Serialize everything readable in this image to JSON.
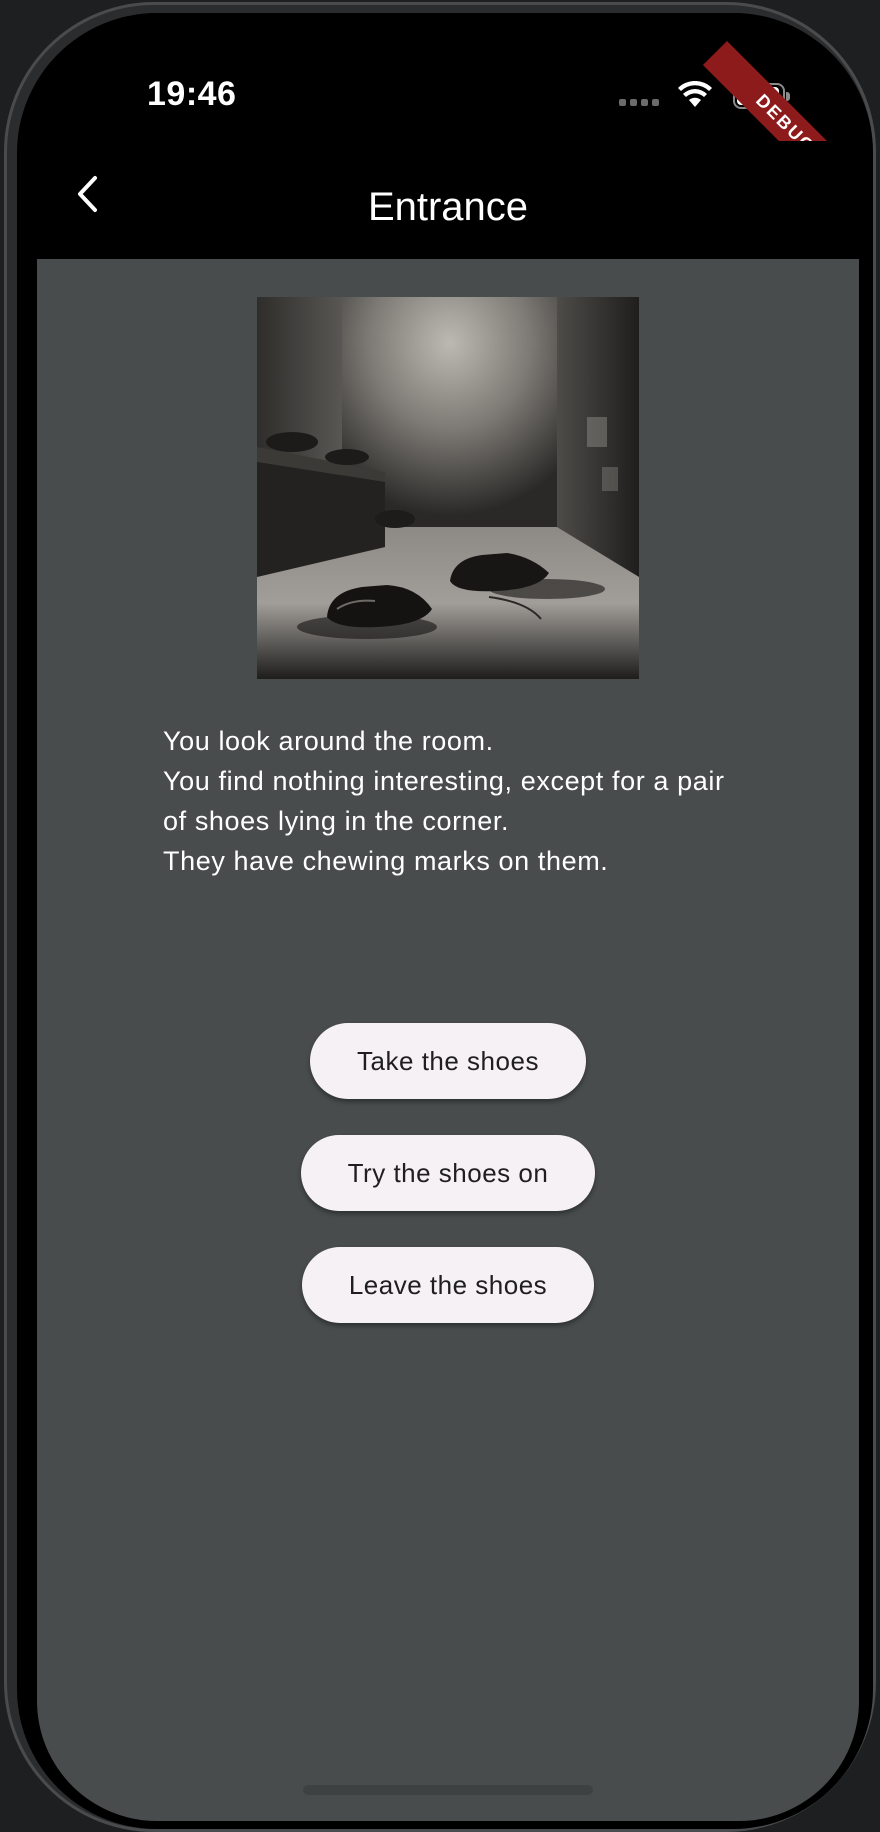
{
  "status_bar": {
    "time": "19:46",
    "debug_label": "DEBUG"
  },
  "app_bar": {
    "title": "Entrance",
    "back_icon": "chevron-left-icon"
  },
  "scene": {
    "image_alt": "Dim room with a pair of worn shoes on the floor",
    "story_lines": [
      "You look around the room.",
      "You find nothing interesting, except for a pair of shoes lying in the corner.",
      "They have chewing marks on them."
    ]
  },
  "choices": [
    {
      "label": "Take the shoes"
    },
    {
      "label": "Try the shoes on"
    },
    {
      "label": "Leave the shoes"
    }
  ],
  "colors": {
    "content_background": "#484c4c",
    "app_bar_background": "#000000",
    "button_background": "#f6f1f4",
    "debug_ribbon": "#8e1b1b"
  }
}
